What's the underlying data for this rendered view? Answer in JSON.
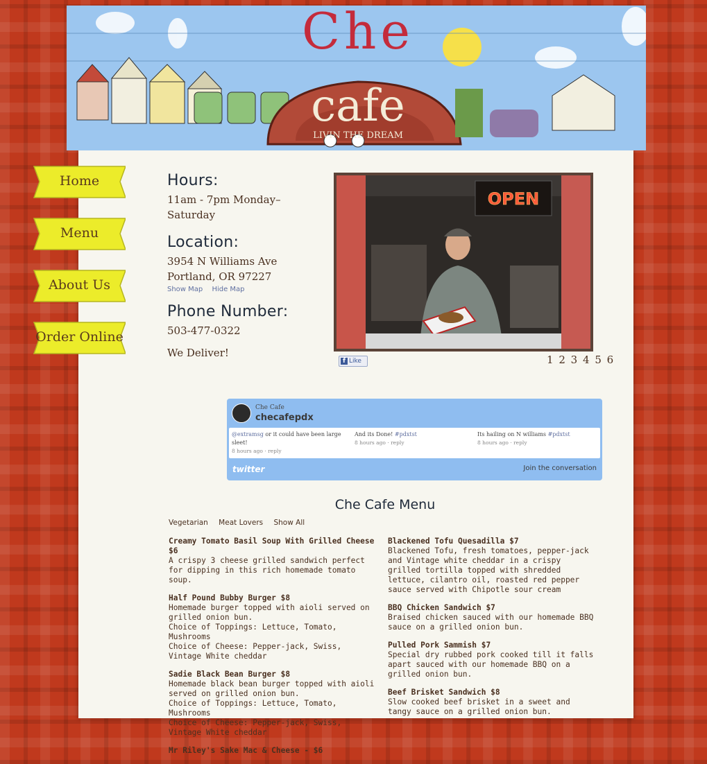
{
  "header": {
    "logo_text": "Che Cafe",
    "tagline": "LIVIN THE DREAM"
  },
  "nav": {
    "items": [
      {
        "label": "Home"
      },
      {
        "label": "Menu"
      },
      {
        "label": "About Us"
      },
      {
        "label": "Order Online"
      }
    ]
  },
  "info": {
    "hours_heading": "Hours:",
    "hours": "11am - 7pm Monday–Saturday",
    "location_heading": "Location:",
    "address_line1": "3954 N Williams Ave",
    "address_line2": "Portland, OR 97227",
    "show_map": "Show Map",
    "hide_map": "Hide Map",
    "phone_heading": "Phone Number:",
    "phone": "503-477-0322",
    "deliver": "We Deliver!"
  },
  "slideshow": {
    "sign_text": "OPEN",
    "like_label": "Like",
    "pages": [
      "1",
      "2",
      "3",
      "4",
      "5",
      "6"
    ]
  },
  "twitter": {
    "name": "Che Cafe",
    "handle": "checafepdx",
    "tweets": [
      {
        "mention": "@extramsg",
        "text": " or it could have been large sleet!",
        "meta": "8 hours ago · reply"
      },
      {
        "mention": "",
        "text": "And its Done! ",
        "tag": "#pdxtst",
        "meta": "8 hours ago · reply"
      },
      {
        "mention": "",
        "text": "Its hailing on N williams ",
        "tag": "#pdxtst",
        "meta": "8 hours ago · reply"
      }
    ],
    "logo": "twitter",
    "join": "Join the conversation"
  },
  "menu": {
    "title": "Che Cafe Menu",
    "filters": [
      "Vegetarian",
      "Meat Lovers",
      "Show All"
    ],
    "left": [
      {
        "title": "Creamy Tomato Basil Soup With Grilled Cheese $6",
        "desc": "A crispy 3 cheese grilled sandwich perfect for dipping in this rich homemade tomato soup."
      },
      {
        "title": "Half Pound Bubby Burger $8",
        "desc": "Homemade burger topped with aioli served on grilled onion bun.",
        "toppings": "Choice of Toppings: Lettuce, Tomato, Mushrooms",
        "cheese": "Choice of Cheese: Pepper-jack, Swiss, Vintage White cheddar"
      },
      {
        "title": "Sadie Black Bean Burger $8",
        "desc": "Homemade black bean burger topped with aioli served on grilled onion bun.",
        "toppings": "Choice of Toppings: Lettuce, Tomato, Mushrooms",
        "cheese": "Choice of Cheese: Pepper-jack, Swiss, Vintage White cheddar"
      },
      {
        "title": "Mr Riley's Sake Mac & Cheese - $6",
        "desc": ""
      }
    ],
    "right": [
      {
        "title": "Blackened Tofu Quesadilla $7",
        "desc": "Blackened Tofu, fresh tomatoes, pepper-jack and Vintage white cheddar in a crispy grilled tortilla topped with shredded lettuce, cilantro oil, roasted red pepper sauce served with Chipotle sour cream"
      },
      {
        "title": "BBQ Chicken Sandwich $7",
        "desc": "Braised chicken sauced with our homemade BBQ sauce on a grilled onion bun."
      },
      {
        "title": "Pulled Pork Sammish $7",
        "desc": "Special dry rubbed pork cooked till it falls apart sauced with our homemade BBQ on a grilled onion bun."
      },
      {
        "title": "Beef Brisket Sandwich $8",
        "desc": "Slow cooked beef brisket in a sweet and tangy sauce on a grilled onion bun."
      }
    ]
  },
  "colors": {
    "background": "#c0391d",
    "panel": "#f7f6ef",
    "nav_button": "#ecec2a",
    "twitter_blue": "#8fbdf0",
    "text_brown": "#4a3020"
  }
}
